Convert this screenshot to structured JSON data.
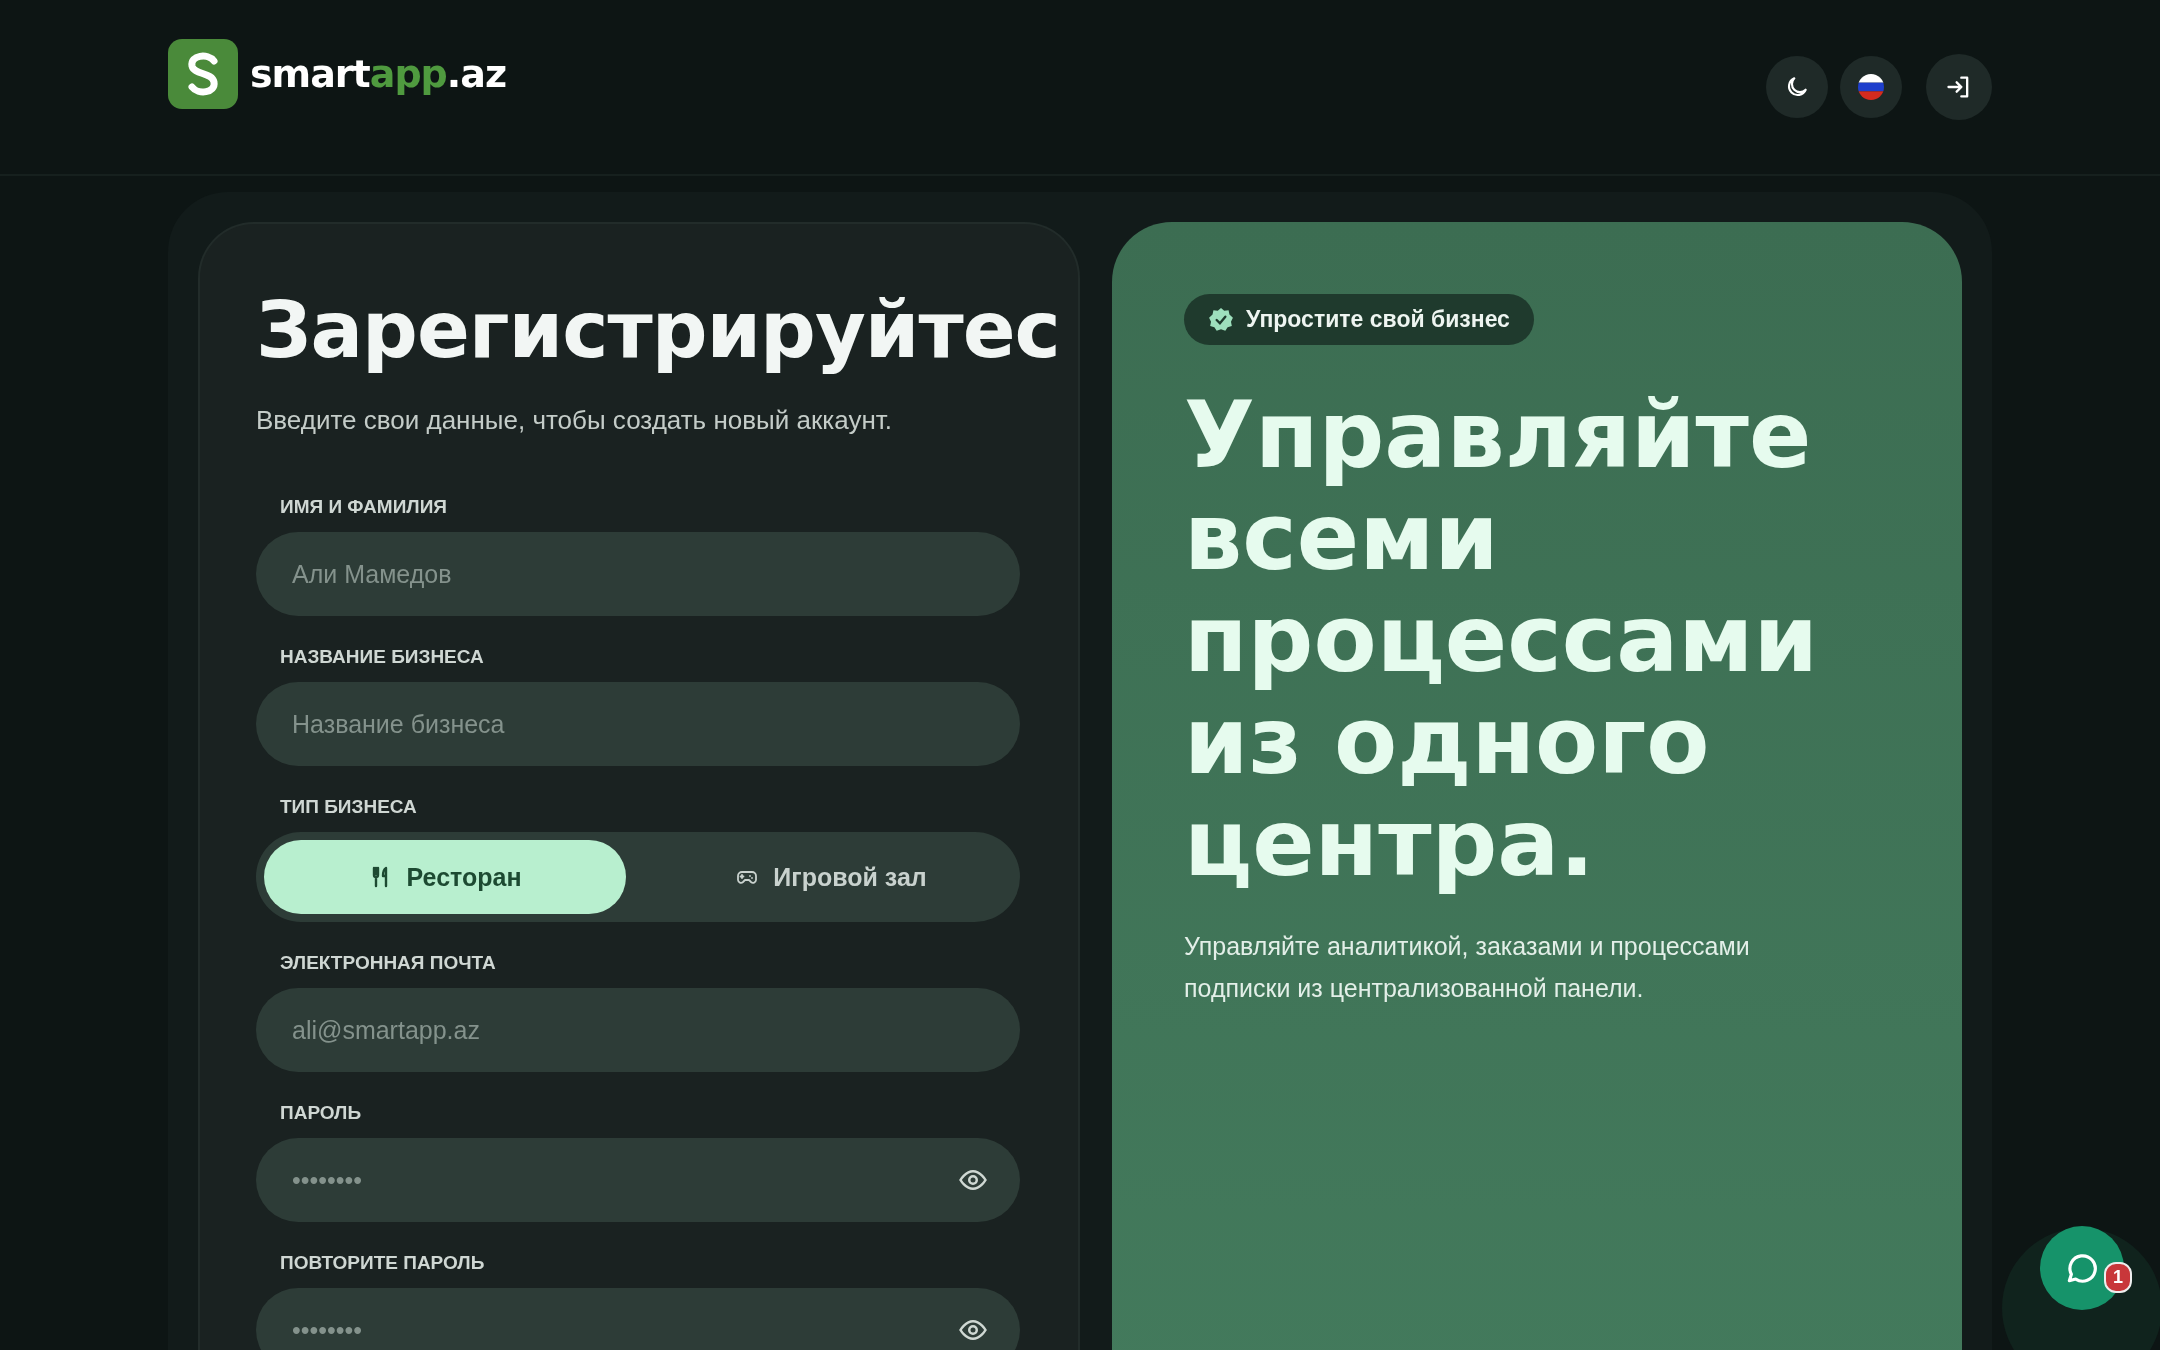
{
  "header": {
    "logo": {
      "parts": [
        {
          "text": "smart",
          "accent": false
        },
        {
          "text": "app",
          "accent": true
        },
        {
          "text": ".az",
          "accent": false
        }
      ]
    },
    "actions": [
      {
        "kind": "theme"
      },
      {
        "kind": "language"
      },
      {
        "kind": "login"
      }
    ]
  },
  "form": {
    "title": "Зарегистрируйтес",
    "subtitle": "Введите свои данные, чтобы создать новый аккаунт.",
    "fields": [
      {
        "kind": "text",
        "label": "ИМЯ И ФАМИЛИЯ",
        "placeholder": "Али Мамедов"
      },
      {
        "kind": "text",
        "label": "НАЗВАНИЕ БИЗНЕСА",
        "placeholder": "Название бизнеса"
      },
      {
        "kind": "choice",
        "label": "ТИП БИЗНЕСА",
        "options": [
          {
            "kind": "restaurant",
            "label": "Ресторан",
            "selected": true
          },
          {
            "kind": "arcade",
            "label": "Игровой зал",
            "selected": false
          }
        ]
      },
      {
        "kind": "text",
        "label": "ЭЛЕКТРОННАЯ ПОЧТА",
        "placeholder": "ali@smartapp.az"
      },
      {
        "kind": "password",
        "label": "ПАРОЛЬ",
        "placeholder": "••••••••"
      },
      {
        "kind": "password",
        "label": "ПОВТОРИТЕ ПАРОЛЬ",
        "placeholder": "••••••••"
      }
    ]
  },
  "promo": {
    "badge": "Упростите свой бизнес",
    "headline": "Управляйте всеми процессами из одного центра.",
    "text": "Управляйте аналитикой, заказами и процессами подписки из централизованной панели."
  },
  "chat": {
    "count": "1"
  }
}
